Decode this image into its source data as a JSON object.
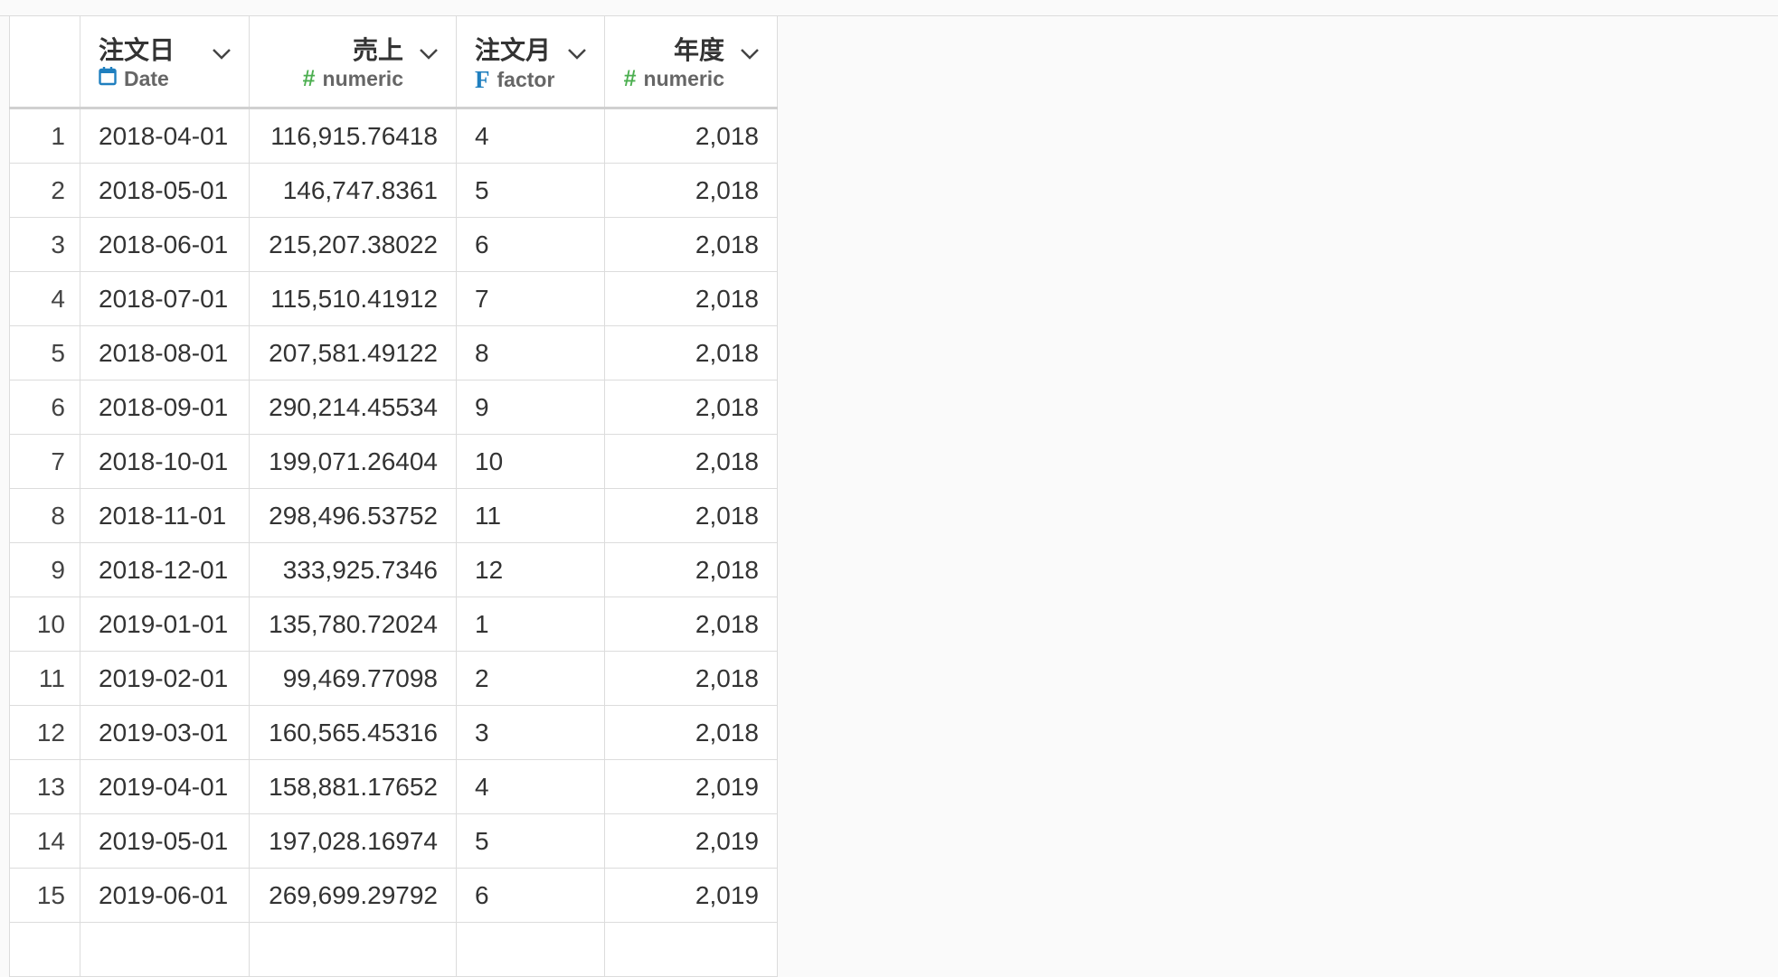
{
  "columns": [
    {
      "name": "注文日",
      "type": "Date",
      "type_icon": "calendar-icon",
      "align": "left"
    },
    {
      "name": "売上",
      "type": "numeric",
      "type_icon": "hash-icon",
      "align": "right"
    },
    {
      "name": "注文月",
      "type": "factor",
      "type_icon": "factor-icon",
      "align": "left"
    },
    {
      "name": "年度",
      "type": "numeric",
      "type_icon": "hash-icon",
      "align": "right"
    }
  ],
  "colors": {
    "numeric_icon": "#4caf50",
    "factor_icon": "#1f7fbf",
    "date_icon": "#1f7fbf"
  },
  "rows": [
    {
      "idx": "1",
      "date": "2018-04-01",
      "sales": "116,915.76418",
      "month": "4",
      "year": "2,018"
    },
    {
      "idx": "2",
      "date": "2018-05-01",
      "sales": "146,747.8361",
      "month": "5",
      "year": "2,018"
    },
    {
      "idx": "3",
      "date": "2018-06-01",
      "sales": "215,207.38022",
      "month": "6",
      "year": "2,018"
    },
    {
      "idx": "4",
      "date": "2018-07-01",
      "sales": "115,510.41912",
      "month": "7",
      "year": "2,018"
    },
    {
      "idx": "5",
      "date": "2018-08-01",
      "sales": "207,581.49122",
      "month": "8",
      "year": "2,018"
    },
    {
      "idx": "6",
      "date": "2018-09-01",
      "sales": "290,214.45534",
      "month": "9",
      "year": "2,018"
    },
    {
      "idx": "7",
      "date": "2018-10-01",
      "sales": "199,071.26404",
      "month": "10",
      "year": "2,018"
    },
    {
      "idx": "8",
      "date": "2018-11-01",
      "sales": "298,496.53752",
      "month": "11",
      "year": "2,018"
    },
    {
      "idx": "9",
      "date": "2018-12-01",
      "sales": "333,925.7346",
      "month": "12",
      "year": "2,018"
    },
    {
      "idx": "10",
      "date": "2019-01-01",
      "sales": "135,780.72024",
      "month": "1",
      "year": "2,018"
    },
    {
      "idx": "11",
      "date": "2019-02-01",
      "sales": "99,469.77098",
      "month": "2",
      "year": "2,018"
    },
    {
      "idx": "12",
      "date": "2019-03-01",
      "sales": "160,565.45316",
      "month": "3",
      "year": "2,018"
    },
    {
      "idx": "13",
      "date": "2019-04-01",
      "sales": "158,881.17652",
      "month": "4",
      "year": "2,019"
    },
    {
      "idx": "14",
      "date": "2019-05-01",
      "sales": "197,028.16974",
      "month": "5",
      "year": "2,019"
    },
    {
      "idx": "15",
      "date": "2019-06-01",
      "sales": "269,699.29792",
      "month": "6",
      "year": "2,019"
    },
    {
      "idx": "",
      "date": "",
      "sales": "",
      "month": "",
      "year": ""
    }
  ]
}
